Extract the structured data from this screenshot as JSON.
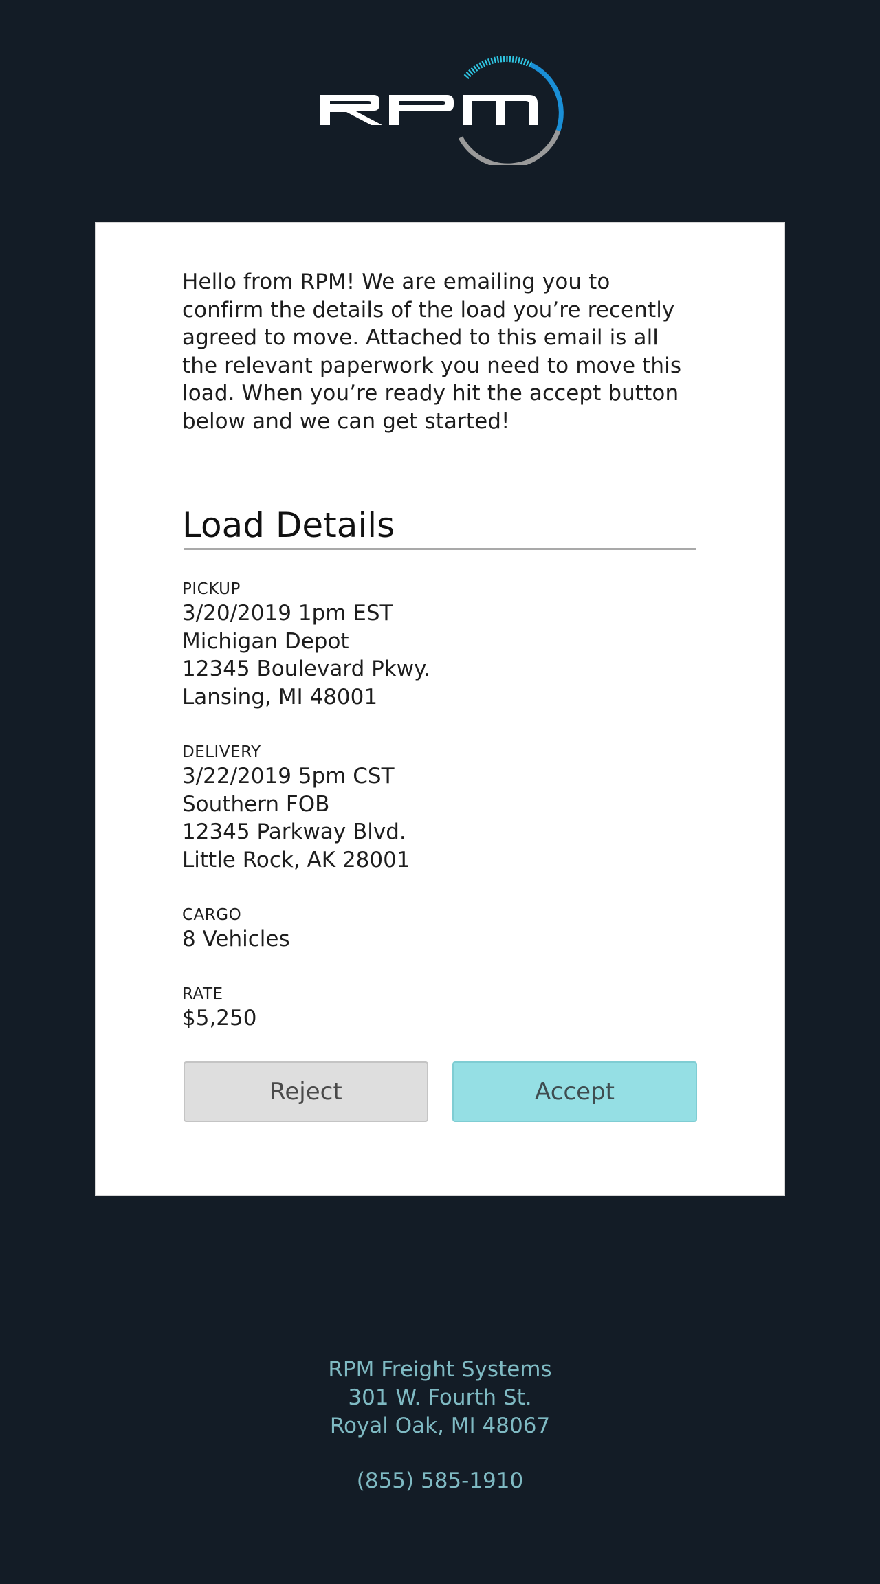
{
  "brand": {
    "logo_text": "RPM"
  },
  "intro": {
    "text": "Hello from RPM! We are emailing you to confirm the details of the load you’re recently agreed to move. Attached to this email is all the relevant paperwork you need to move this load. When you’re ready hit the accept button below and we can get started!"
  },
  "details": {
    "title": "Load Details",
    "pickup": {
      "label": "PICKUP",
      "datetime": "3/20/2019 1pm EST",
      "location": "Michigan Depot",
      "street": "12345 Boulevard Pkwy.",
      "city": "Lansing, MI 48001"
    },
    "delivery": {
      "label": "DELIVERY",
      "datetime": "3/22/2019 5pm CST",
      "location": "Southern FOB",
      "street": "12345 Parkway Blvd.",
      "city": "Little Rock, AK 28001"
    },
    "cargo": {
      "label": "CARGO",
      "value": "8 Vehicles"
    },
    "rate": {
      "label": "RATE",
      "value": "$5,250"
    }
  },
  "actions": {
    "reject_label": "Reject",
    "accept_label": "Accept"
  },
  "footer": {
    "company": "RPM Freight Systems",
    "street": "301 W. Fourth St.",
    "city": "Royal Oak, MI 48067",
    "phone": "(855) 585-1910"
  },
  "colors": {
    "background": "#131c26",
    "card": "#ffffff",
    "accept_button": "#95dfe4",
    "reject_button": "#dedede",
    "footer_text": "#7fbac3",
    "logo_arc_accent": "#1fb6e0"
  }
}
